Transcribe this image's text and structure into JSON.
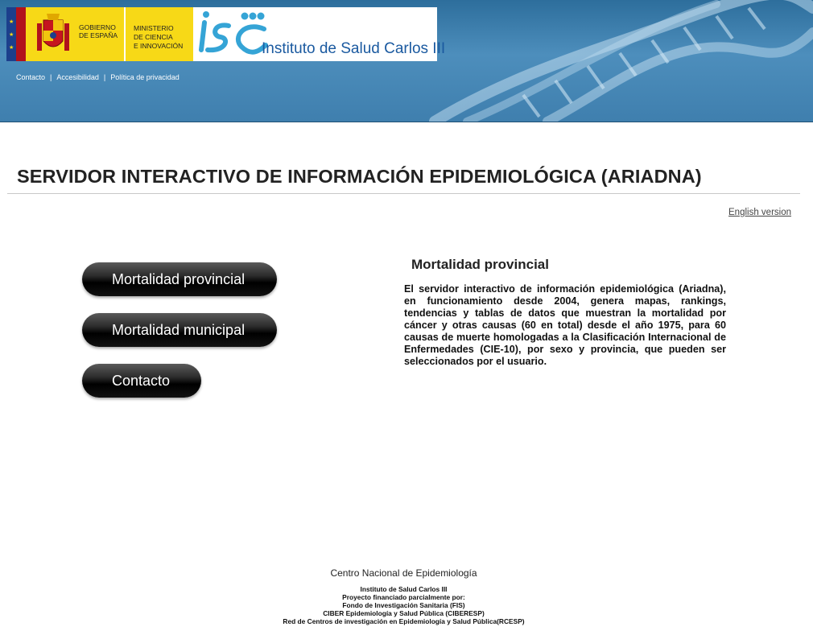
{
  "header": {
    "government_text": "Gobierno\nde España",
    "ministry_text": "Ministerio\nde Ciencia\ne Innovación",
    "institute_name": "Instituto de Salud Carlos III",
    "util_nav": [
      {
        "label": "Contacto"
      },
      {
        "label": "Accesibilidad"
      },
      {
        "label": "Política de privacidad"
      }
    ],
    "separator": "|",
    "brand_colors": {
      "blue": "#3f7fae",
      "yellow": "#f7d917",
      "red": "#b1121c"
    }
  },
  "page_title": "SERVIDOR INTERACTIVO DE INFORMACIÓN EPIDEMIOLÓGICA (ARIADNA)",
  "language_link": "English version",
  "menu": {
    "mortalidad_provincial": "Mortalidad provincial",
    "mortalidad_municipal": "Mortalidad municipal",
    "contacto": "Contacto"
  },
  "content": {
    "section_title": "Mortalidad provincial",
    "description": "El servidor interactivo de información epidemiológica (Ariadna), en funcionamiento desde 2004, genera mapas, rankings, tendencias y tablas de datos que muestran la mortalidad por cáncer y otras causas (60 en total) desde el año 1975, para 60 causas de muerte homologadas a la Clasificación Internacional de Enfermedades (CIE-10), por sexo y provincia, que pueden ser seleccionados por el usuario."
  },
  "footer": {
    "center_name": "Centro Nacional de Epidemiología",
    "lines": [
      "Instituto de Salud Carlos III",
      "Proyecto financiado parcialmente por:",
      "Fondo de Investigación Sanitaria (FIS)",
      "CIBER Epidemiología y Salud Pública (CIBERESP)",
      "Red de Centros de investigación en Epidemiología y Salud Pública(RCESP)"
    ]
  }
}
